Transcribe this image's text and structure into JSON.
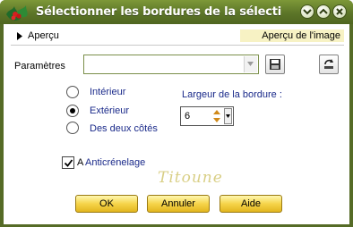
{
  "window": {
    "title": "Sélectionner les bordures de la sélecti",
    "accent": "#556b26"
  },
  "preview": {
    "toggle_label": "Aperçu",
    "image_preview_label": "Aperçu de l'image"
  },
  "settings": {
    "params_label": "Paramètres",
    "preset_value": ""
  },
  "border": {
    "options": [
      {
        "label": "Intérieur",
        "checked": false
      },
      {
        "label": "Extérieur",
        "checked": true
      },
      {
        "label": "Des deux côtés",
        "checked": false
      }
    ],
    "width_label": "Largeur de la bordure :",
    "width_value": "6"
  },
  "antialias": {
    "truncated_label": "A",
    "label": "Anticrénelage",
    "checked": true
  },
  "watermark": "Titoune",
  "buttons": {
    "ok": "OK",
    "cancel": "Annuler",
    "help": "Aide"
  }
}
